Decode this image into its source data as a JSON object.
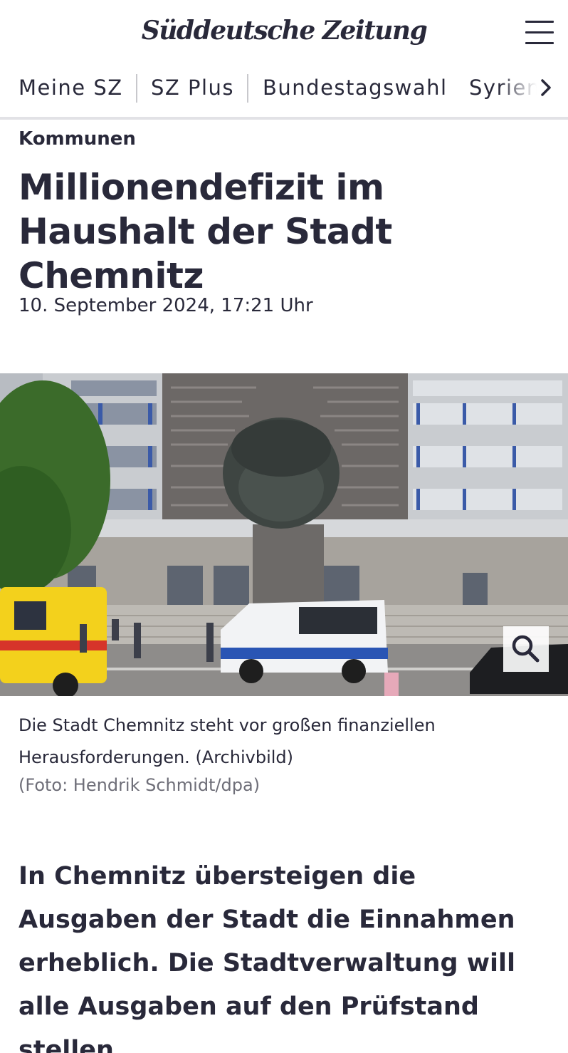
{
  "header": {
    "logo_text": "Süddeutsche Zeitung",
    "menu_icon": "hamburger-menu-icon"
  },
  "nav": {
    "items": [
      {
        "label": "Meine SZ"
      },
      {
        "label": "SZ Plus"
      },
      {
        "label": "Bundestagswahl"
      },
      {
        "label": "Syrien"
      }
    ],
    "more_icon": "chevron-right-icon"
  },
  "article": {
    "kicker": "Kommunen",
    "headline": "Millionendefizit im Haushalt der Stadt Chemnitz",
    "date": "10. September 2024, 17:21 Uhr",
    "image": {
      "zoom_icon": "magnifier-icon"
    },
    "caption": "Die Stadt Chemnitz steht vor großen finanziellen Herausforderungen. (Archivbild)",
    "credit": "(Foto: Hendrik Schmidt/dpa)",
    "lead": "In Chemnitz übersteigen die Ausgaben der Stadt die Einnahmen erheblich. Die Stadtverwaltung will alle Ausgaben auf den Prüfstand stellen."
  },
  "colors": {
    "text": "#29293a",
    "muted": "#6e6e78",
    "divider": "#e2e2e6"
  }
}
